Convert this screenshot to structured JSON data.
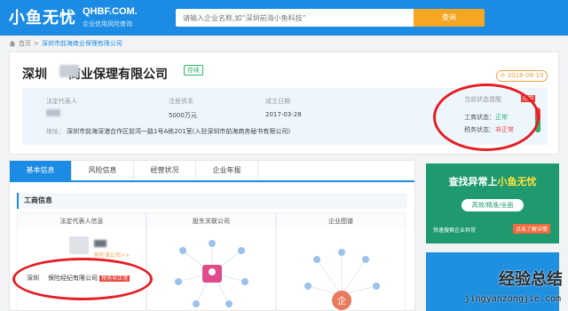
{
  "header": {
    "logo_cn": "小鱼无忧",
    "logo_en": "QHBF.COM.",
    "logo_sub": "企业信用风险查询",
    "search_placeholder": "请输入企业名称,如“深圳前海小鱼科技”",
    "search_button": "查询"
  },
  "breadcrumb": {
    "home": "首页",
    "sep": ">",
    "current": "深圳市前海商业保理有限公司"
  },
  "company": {
    "name_prefix": "深圳",
    "name_suffix": "商业保理有限公司",
    "status_tag": "存续",
    "date": "2018-09-19",
    "legal_rep_label": "法定代表人",
    "capital_label": "注册资本",
    "capital_value": "5000万元",
    "founded_label": "成立日期",
    "founded_value": "2017-03-28",
    "address_label": "地址：",
    "address_value": "深圳市前海深港合作区前湾一路1号A栋201室(入驻深圳市前海商务秘书有限公司)",
    "status_title": "当前状态提醒",
    "alert_badge": "危险",
    "biz_status_label": "工商状态：",
    "biz_status_value": "正常",
    "tax_status_label": "税务状态：",
    "tax_status_value": "非正常",
    "health_fraction": 0.55
  },
  "tabs": [
    {
      "label": "基本信息"
    },
    {
      "label": "风险信息"
    },
    {
      "label": "经营状况"
    },
    {
      "label": "企业年报"
    }
  ],
  "section": {
    "title": "工商信息",
    "col1_title": "法定代表人信息",
    "col2_title": "股东关联公司",
    "col3_title": "企业图谱",
    "legal_tag": "他在该公司>>",
    "company_prefix": "深圳",
    "company_suffix": "保险经纪有限公司",
    "company_chip": "税务非正常"
  },
  "ad": {
    "title_main": "查找异常上",
    "title_hl": "小鱼无忧",
    "pill": "高效/精准/全面",
    "foot": "快速搜索企业异常",
    "btn": "点击了解详情"
  },
  "watermark": {
    "brand": "经验总结",
    "url": "jingyanzongjie.com"
  },
  "colors": {
    "primary": "#1b8be3",
    "danger": "#e8453c",
    "ok": "#2fb36a",
    "accent": "#f5a623"
  }
}
